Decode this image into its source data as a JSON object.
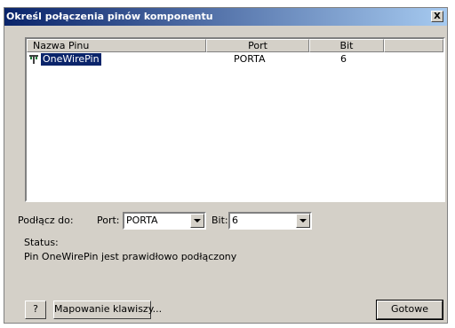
{
  "dialog": {
    "title": "Określ połączenia pinów komponentu",
    "close_label": "X"
  },
  "list": {
    "columns": [
      "Nazwa Pinu",
      "Port",
      "Bit"
    ],
    "rows": [
      {
        "name": "OneWirePin",
        "port": "PORTA",
        "bit": "6",
        "icon": "pin-icon",
        "selected": true
      }
    ]
  },
  "connect": {
    "label": "Podłącz do:",
    "port_label": "Port:",
    "port_value": "PORTA",
    "bit_label": "Bit:",
    "bit_value": "6"
  },
  "status": {
    "label": "Status:",
    "message": "Pin OneWirePin jest prawidłowo podłączony"
  },
  "buttons": {
    "help": "?",
    "mapping": "Mapowanie klawiszy...",
    "done": "Gotowe"
  },
  "colors": {
    "titlebar_start": "#0a246a",
    "titlebar_end": "#a6caf0",
    "face": "#d4d0c8",
    "selection": "#0a246a"
  }
}
